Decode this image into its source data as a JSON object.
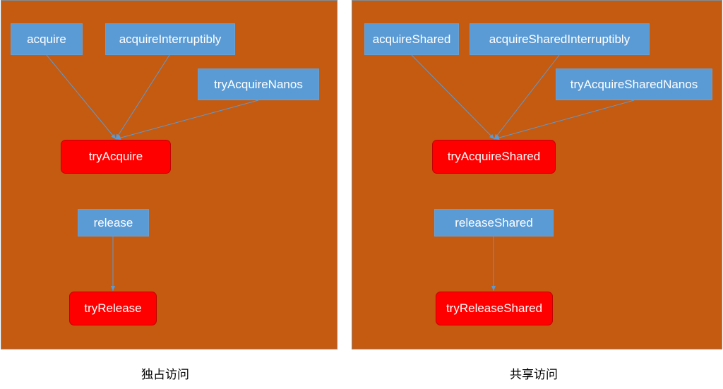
{
  "exclusive": {
    "callers": [
      "acquire",
      "acquireInterruptibly",
      "tryAcquireNanos"
    ],
    "acquire_target": "tryAcquire",
    "release": "release",
    "release_target": "tryRelease",
    "caption": "独占访问"
  },
  "shared": {
    "callers": [
      "acquireShared",
      "acquireSharedInterruptibly",
      "tryAcquireSharedNanos"
    ],
    "acquire_target": "tryAcquireShared",
    "release": "releaseShared",
    "release_target": "tryReleaseShared",
    "caption": "共享访问"
  },
  "colors": {
    "panel": "#c55a11",
    "method_box": "#5b9bd5",
    "template_box": "#ff0000",
    "arrow": "#5b9bd5"
  }
}
